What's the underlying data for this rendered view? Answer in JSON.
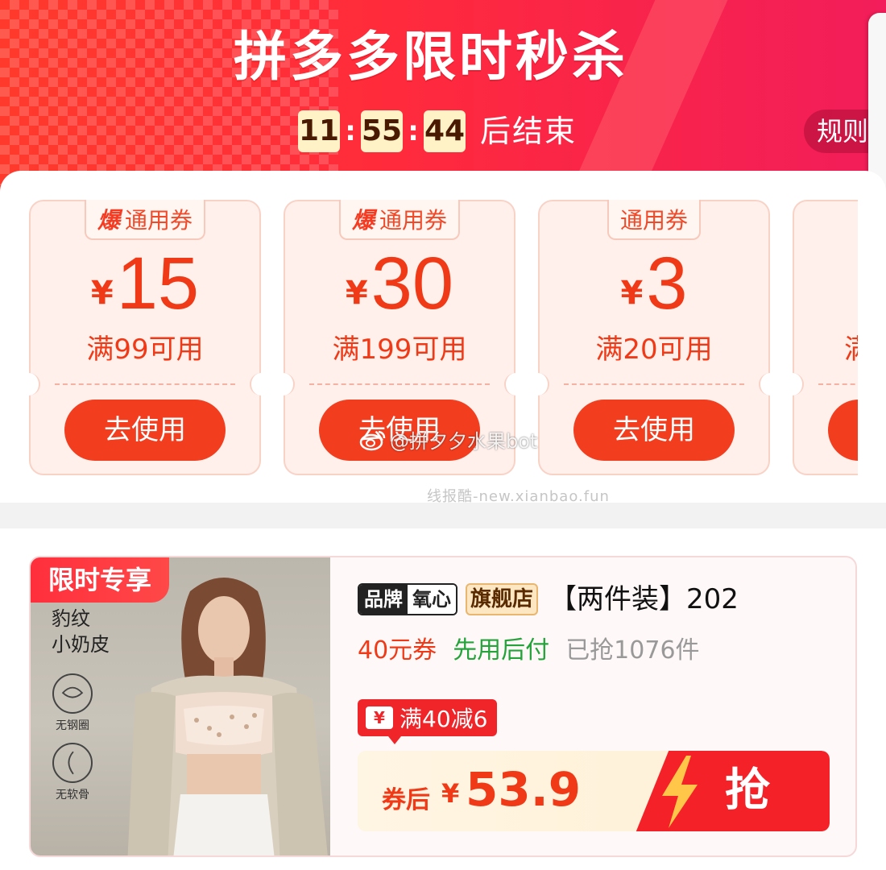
{
  "header": {
    "title": "拼多多限时秒杀",
    "countdown": {
      "hours": "11",
      "minutes": "55",
      "seconds": "44",
      "suffix": "后结束"
    },
    "rules_label": "规则"
  },
  "coupons": [
    {
      "hot": "爆",
      "tag": "通用券",
      "currency": "¥",
      "amount": "15",
      "condition": "满99可用",
      "button": "去使用"
    },
    {
      "hot": "爆",
      "tag": "通用券",
      "currency": "¥",
      "amount": "30",
      "condition": "满199可用",
      "button": "去使用"
    },
    {
      "hot": "",
      "tag": "通用券",
      "currency": "¥",
      "amount": "3",
      "condition": "满20可用",
      "button": "去使用"
    },
    {
      "hot": "",
      "tag": "",
      "currency": "",
      "amount": "",
      "condition": "满",
      "button": ""
    }
  ],
  "watermarks": {
    "site": "线报酷-new.xianbao.fun",
    "weibo": "@拼夕夕水果bot"
  },
  "product": {
    "limited_badge": "限时专享",
    "image_text_line1": "豹纹",
    "image_text_line2": "小奶皮",
    "feature_1": "无钢圈",
    "feature_2": "无软骨",
    "brand_label": "品牌",
    "brand_name": "氧心",
    "store_label": "旗舰店",
    "title": "【两件装】202",
    "coupon_tag": "40元券",
    "pay_later": "先用后付",
    "sold": "已抢1076件",
    "discount_icon": "¥",
    "discount": "满40减6",
    "price_prefix": "券后",
    "price_currency": "¥",
    "price": "53.9",
    "grab_button": "抢"
  },
  "colors": {
    "header_red": "#ff3a2c",
    "header_pink": "#f21d5a",
    "coupon_red": "#f23d1f",
    "pay_later_green": "#24a33a"
  }
}
